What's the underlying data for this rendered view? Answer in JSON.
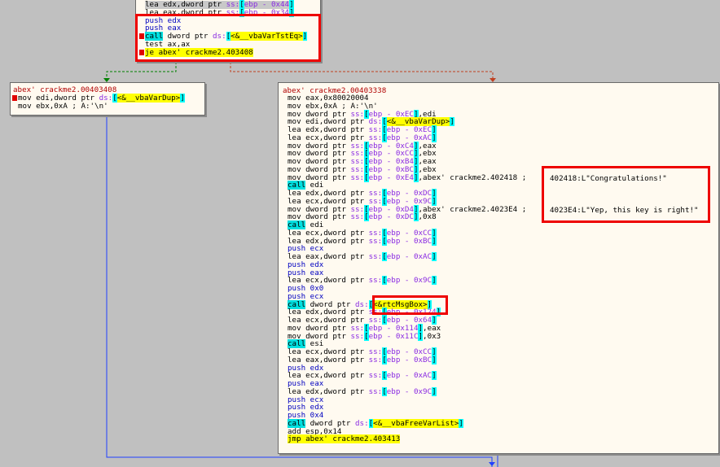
{
  "top_block": {
    "lines": [
      {
        "parts": [
          [
            "lea",
            "n"
          ],
          [
            " edx,dword ptr ",
            "o"
          ],
          [
            "ss:",
            "s"
          ],
          [
            "[",
            "b"
          ],
          [
            "ebp - 0x44",
            "s"
          ],
          [
            "]",
            "b"
          ]
        ],
        "selected": true
      },
      {
        "parts": [
          [
            "lea",
            "n"
          ],
          [
            " eax,dword ptr ",
            "o"
          ],
          [
            "ss:",
            "s"
          ],
          [
            "[",
            "b"
          ],
          [
            "ebp - 0x34",
            "s"
          ],
          [
            "]",
            "b"
          ]
        ]
      },
      {
        "parts": [
          [
            "push",
            "p"
          ],
          [
            " edx",
            "p"
          ]
        ]
      },
      {
        "parts": [
          [
            "push",
            "p"
          ],
          [
            " eax",
            "p"
          ]
        ]
      },
      {
        "bp": true,
        "parts": [
          [
            "call",
            "c"
          ],
          [
            " dword ptr ",
            "o"
          ],
          [
            "ds:",
            "s"
          ],
          [
            "[",
            "b"
          ],
          [
            "<&__vbaVarTstEq>",
            "y"
          ],
          [
            "]",
            "b"
          ]
        ]
      },
      {
        "parts": [
          [
            "test",
            "n"
          ],
          [
            " ax,ax",
            "o"
          ]
        ]
      },
      {
        "bp": true,
        "parts": [
          [
            "je",
            "j"
          ],
          [
            " abex' crackme2.403408",
            "y"
          ]
        ]
      }
    ]
  },
  "left_block": {
    "title": "abex' crackme2.00403408",
    "lines": [
      {
        "bp": true,
        "parts": [
          [
            "mov",
            "n"
          ],
          [
            " edi,dword ptr ",
            "o"
          ],
          [
            "ds:",
            "s"
          ],
          [
            "[",
            "b"
          ],
          [
            "<&__vbaVarDup>",
            "y"
          ],
          [
            "]",
            "b"
          ]
        ]
      },
      {
        "parts": [
          [
            "mov",
            "n"
          ],
          [
            " ebx,0xA ; A:'\\n'",
            "o"
          ]
        ]
      }
    ]
  },
  "main_block": {
    "title": "abex' crackme2.00403338",
    "lines": [
      {
        "parts": [
          [
            "mov",
            "n"
          ],
          [
            " eax,0x80020004",
            "o"
          ]
        ]
      },
      {
        "parts": [
          [
            "mov",
            "n"
          ],
          [
            " ebx,0xA ; A:'\\n'",
            "o"
          ]
        ]
      },
      {
        "parts": [
          [
            "mov",
            "n"
          ],
          [
            " dword ptr ",
            "o"
          ],
          [
            "ss:",
            "s"
          ],
          [
            "[",
            "b"
          ],
          [
            "ebp - 0xEC",
            "s"
          ],
          [
            "]",
            "b"
          ],
          [
            ",edi",
            "o"
          ]
        ]
      },
      {
        "parts": [
          [
            "mov",
            "n"
          ],
          [
            " edi,dword ptr ",
            "o"
          ],
          [
            "ds:",
            "s"
          ],
          [
            "[",
            "b"
          ],
          [
            "<&__vbaVarDup>",
            "y"
          ],
          [
            "]",
            "b"
          ]
        ]
      },
      {
        "parts": [
          [
            "lea",
            "n"
          ],
          [
            " edx,dword ptr ",
            "o"
          ],
          [
            "ss:",
            "s"
          ],
          [
            "[",
            "b"
          ],
          [
            "ebp - 0xEC",
            "s"
          ],
          [
            "]",
            "b"
          ]
        ]
      },
      {
        "parts": [
          [
            "lea",
            "n"
          ],
          [
            " ecx,dword ptr ",
            "o"
          ],
          [
            "ss:",
            "s"
          ],
          [
            "[",
            "b"
          ],
          [
            "ebp - 0xAC",
            "s"
          ],
          [
            "]",
            "b"
          ]
        ]
      },
      {
        "parts": [
          [
            "mov",
            "n"
          ],
          [
            " dword ptr ",
            "o"
          ],
          [
            "ss:",
            "s"
          ],
          [
            "[",
            "b"
          ],
          [
            "ebp - 0xC4",
            "s"
          ],
          [
            "]",
            "b"
          ],
          [
            ",eax",
            "o"
          ]
        ]
      },
      {
        "parts": [
          [
            "mov",
            "n"
          ],
          [
            " dword ptr ",
            "o"
          ],
          [
            "ss:",
            "s"
          ],
          [
            "[",
            "b"
          ],
          [
            "ebp - 0xCC",
            "s"
          ],
          [
            "]",
            "b"
          ],
          [
            ",ebx",
            "o"
          ]
        ]
      },
      {
        "parts": [
          [
            "mov",
            "n"
          ],
          [
            " dword ptr ",
            "o"
          ],
          [
            "ss:",
            "s"
          ],
          [
            "[",
            "b"
          ],
          [
            "ebp - 0xB4",
            "s"
          ],
          [
            "]",
            "b"
          ],
          [
            ",eax",
            "o"
          ]
        ]
      },
      {
        "parts": [
          [
            "mov",
            "n"
          ],
          [
            " dword ptr ",
            "o"
          ],
          [
            "ss:",
            "s"
          ],
          [
            "[",
            "b"
          ],
          [
            "ebp - 0xBC",
            "s"
          ],
          [
            "]",
            "b"
          ],
          [
            ",ebx",
            "o"
          ]
        ]
      },
      {
        "parts": [
          [
            "mov",
            "n"
          ],
          [
            " dword ptr ",
            "o"
          ],
          [
            "ss:",
            "s"
          ],
          [
            "[",
            "b"
          ],
          [
            "ebp - 0xE4",
            "s"
          ],
          [
            "]",
            "b"
          ],
          [
            ",abex' crackme2.402418 ; ",
            "o"
          ]
        ]
      },
      {
        "parts": [
          [
            "call",
            "c"
          ],
          [
            " edi",
            "o"
          ]
        ]
      },
      {
        "parts": [
          [
            "lea",
            "n"
          ],
          [
            " edx,dword ptr ",
            "o"
          ],
          [
            "ss:",
            "s"
          ],
          [
            "[",
            "b"
          ],
          [
            "ebp - 0xDC",
            "s"
          ],
          [
            "]",
            "b"
          ]
        ]
      },
      {
        "parts": [
          [
            "lea",
            "n"
          ],
          [
            " ecx,dword ptr ",
            "o"
          ],
          [
            "ss:",
            "s"
          ],
          [
            "[",
            "b"
          ],
          [
            "ebp - 0x9C",
            "s"
          ],
          [
            "]",
            "b"
          ]
        ]
      },
      {
        "parts": [
          [
            "mov",
            "n"
          ],
          [
            " dword ptr ",
            "o"
          ],
          [
            "ss:",
            "s"
          ],
          [
            "[",
            "b"
          ],
          [
            "ebp - 0xD4",
            "s"
          ],
          [
            "]",
            "b"
          ],
          [
            ",abex' crackme2.4023E4 ; ",
            "o"
          ]
        ]
      },
      {
        "parts": [
          [
            "mov",
            "n"
          ],
          [
            " dword ptr ",
            "o"
          ],
          [
            "ss:",
            "s"
          ],
          [
            "[",
            "b"
          ],
          [
            "ebp - 0xDC",
            "s"
          ],
          [
            "]",
            "b"
          ],
          [
            ",0x8",
            "o"
          ]
        ]
      },
      {
        "parts": [
          [
            "call",
            "c"
          ],
          [
            " edi",
            "o"
          ]
        ]
      },
      {
        "parts": [
          [
            "lea",
            "n"
          ],
          [
            " ecx,dword ptr ",
            "o"
          ],
          [
            "ss:",
            "s"
          ],
          [
            "[",
            "b"
          ],
          [
            "ebp - 0xCC",
            "s"
          ],
          [
            "]",
            "b"
          ]
        ]
      },
      {
        "parts": [
          [
            "lea",
            "n"
          ],
          [
            " edx,dword ptr ",
            "o"
          ],
          [
            "ss:",
            "s"
          ],
          [
            "[",
            "b"
          ],
          [
            "ebp - 0xBC",
            "s"
          ],
          [
            "]",
            "b"
          ]
        ]
      },
      {
        "parts": [
          [
            "push",
            "p"
          ],
          [
            " ecx",
            "p"
          ]
        ]
      },
      {
        "parts": [
          [
            "lea",
            "n"
          ],
          [
            " eax,dword ptr ",
            "o"
          ],
          [
            "ss:",
            "s"
          ],
          [
            "[",
            "b"
          ],
          [
            "ebp - 0xAC",
            "s"
          ],
          [
            "]",
            "b"
          ]
        ]
      },
      {
        "parts": [
          [
            "push",
            "p"
          ],
          [
            " edx",
            "p"
          ]
        ]
      },
      {
        "parts": [
          [
            "push",
            "p"
          ],
          [
            " eax",
            "p"
          ]
        ]
      },
      {
        "parts": [
          [
            "lea",
            "n"
          ],
          [
            " ecx,dword ptr ",
            "o"
          ],
          [
            "ss:",
            "s"
          ],
          [
            "[",
            "b"
          ],
          [
            "ebp - 0x9C",
            "s"
          ],
          [
            "]",
            "b"
          ]
        ]
      },
      {
        "parts": [
          [
            "push",
            "p"
          ],
          [
            " 0x0",
            "p"
          ]
        ]
      },
      {
        "parts": [
          [
            "push",
            "p"
          ],
          [
            " ecx",
            "p"
          ]
        ]
      },
      {
        "parts": [
          [
            "call",
            "c"
          ],
          [
            " dword ptr ",
            "o"
          ],
          [
            "ds:",
            "s"
          ],
          [
            "[",
            "b"
          ],
          [
            "<&rtcMsgBox>",
            "y"
          ],
          [
            "]",
            "b"
          ]
        ]
      },
      {
        "parts": [
          [
            "lea",
            "n"
          ],
          [
            " edx,dword ptr ",
            "o"
          ],
          [
            "ss:",
            "s"
          ],
          [
            "[",
            "b"
          ],
          [
            "ebp - 0x124",
            "s"
          ],
          [
            "]",
            "b"
          ]
        ]
      },
      {
        "parts": [
          [
            "lea",
            "n"
          ],
          [
            " ecx,dword ptr ",
            "o"
          ],
          [
            "ss:",
            "s"
          ],
          [
            "[",
            "b"
          ],
          [
            "ebp - 0x64",
            "s"
          ],
          [
            "]",
            "b"
          ]
        ]
      },
      {
        "parts": [
          [
            "mov",
            "n"
          ],
          [
            " dword ptr ",
            "o"
          ],
          [
            "ss:",
            "s"
          ],
          [
            "[",
            "b"
          ],
          [
            "ebp - 0x114",
            "s"
          ],
          [
            "]",
            "b"
          ],
          [
            ",eax",
            "o"
          ]
        ]
      },
      {
        "parts": [
          [
            "mov",
            "n"
          ],
          [
            " dword ptr ",
            "o"
          ],
          [
            "ss:",
            "s"
          ],
          [
            "[",
            "b"
          ],
          [
            "ebp - 0x11C",
            "s"
          ],
          [
            "]",
            "b"
          ],
          [
            ",0x3",
            "o"
          ]
        ]
      },
      {
        "parts": [
          [
            "call",
            "c"
          ],
          [
            " esi",
            "o"
          ]
        ]
      },
      {
        "parts": [
          [
            "lea",
            "n"
          ],
          [
            " ecx,dword ptr ",
            "o"
          ],
          [
            "ss:",
            "s"
          ],
          [
            "[",
            "b"
          ],
          [
            "ebp - 0xCC",
            "s"
          ],
          [
            "]",
            "b"
          ]
        ]
      },
      {
        "parts": [
          [
            "lea",
            "n"
          ],
          [
            " eax,dword ptr ",
            "o"
          ],
          [
            "ss:",
            "s"
          ],
          [
            "[",
            "b"
          ],
          [
            "ebp - 0xBC",
            "s"
          ],
          [
            "]",
            "b"
          ]
        ]
      },
      {
        "parts": [
          [
            "push",
            "p"
          ],
          [
            " edx",
            "p"
          ]
        ]
      },
      {
        "parts": [
          [
            "lea",
            "n"
          ],
          [
            " ecx,dword ptr ",
            "o"
          ],
          [
            "ss:",
            "s"
          ],
          [
            "[",
            "b"
          ],
          [
            "ebp - 0xAC",
            "s"
          ],
          [
            "]",
            "b"
          ]
        ]
      },
      {
        "parts": [
          [
            "push",
            "p"
          ],
          [
            " eax",
            "p"
          ]
        ]
      },
      {
        "parts": [
          [
            "lea",
            "n"
          ],
          [
            " edx,dword ptr ",
            "o"
          ],
          [
            "ss:",
            "s"
          ],
          [
            "[",
            "b"
          ],
          [
            "ebp - 0x9C",
            "s"
          ],
          [
            "]",
            "b"
          ]
        ]
      },
      {
        "parts": [
          [
            "push",
            "p"
          ],
          [
            " ecx",
            "p"
          ]
        ]
      },
      {
        "parts": [
          [
            "push",
            "p"
          ],
          [
            " edx",
            "p"
          ]
        ]
      },
      {
        "parts": [
          [
            "push",
            "p"
          ],
          [
            " 0x4",
            "p"
          ]
        ]
      },
      {
        "parts": [
          [
            "call",
            "c"
          ],
          [
            " dword ptr ",
            "o"
          ],
          [
            "ds:",
            "s"
          ],
          [
            "[",
            "b"
          ],
          [
            "<&__vbaFreeVarList>",
            "y"
          ],
          [
            "]",
            "b"
          ]
        ]
      },
      {
        "parts": [
          [
            "add",
            "n"
          ],
          [
            " esp,0x14",
            "o"
          ]
        ]
      },
      {
        "parts": [
          [
            "jmp",
            "j"
          ],
          [
            " abex' crackme2.403413",
            "y"
          ]
        ]
      }
    ],
    "comments": {
      "congrats": "402418:L\"Congratulations!\"",
      "right_key": "4023E4:L\"Yep, this key is right!\""
    }
  },
  "colors": {
    "background": "#c0c0c0",
    "node_fill": "#fffaf0",
    "highlight_box": "#ee0000",
    "edge_true": "#008000",
    "edge_false": "#c04020",
    "edge_jump": "#2040ff"
  }
}
